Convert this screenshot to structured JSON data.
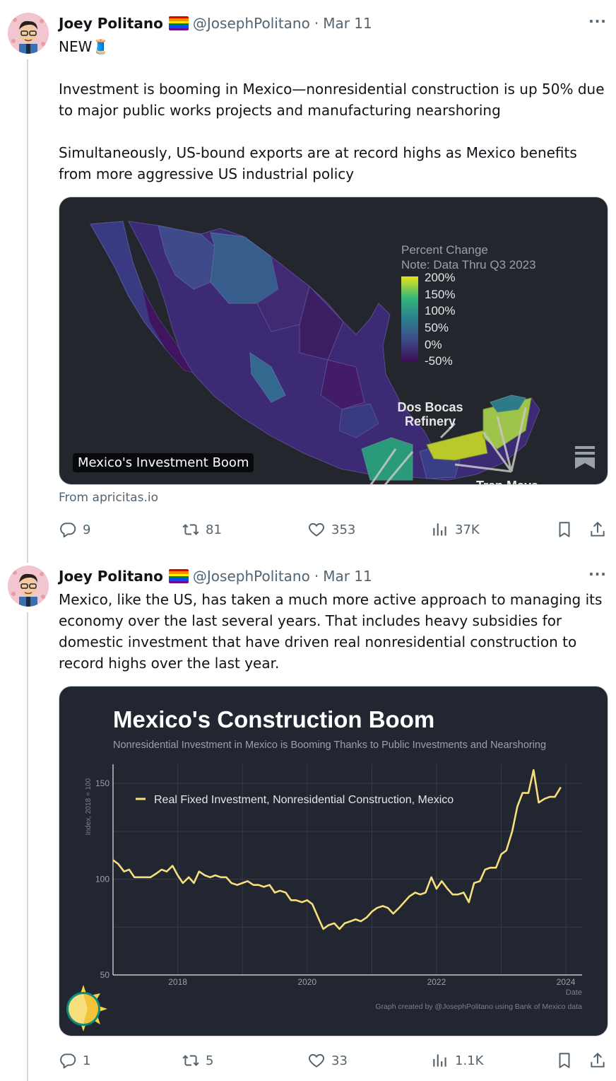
{
  "tweets": [
    {
      "author_name": "Joey Politano",
      "handle": "@JosephPolitano",
      "date": "Mar 11",
      "text": "NEW🧵\n\nInvestment is booming in Mexico—nonresidential construction is up 50% due to major public works projects and manufacturing nearshoring\n\nSimultaneously, US-bound exports are at record highs as Mexico benefits from more aggressive US industrial policy",
      "media": {
        "caption": "Mexico's Investment Boom",
        "legend_title": "Percent Change",
        "legend_note": "Note: Data Thru Q3 2023",
        "legend_ticks": [
          "200%",
          "150%",
          "100%",
          "50%",
          "0%",
          "-50%"
        ],
        "annotation_1": "Dos Bocas",
        "annotation_2": "Refinery",
        "annotation_3": "Tren Maya"
      },
      "source": "From apricitas.io",
      "replies": "9",
      "retweets": "81",
      "likes": "353",
      "views": "37K"
    },
    {
      "author_name": "Joey Politano",
      "handle": "@JosephPolitano",
      "date": "Mar 11",
      "text": "Mexico, like the US, has taken a much more active approach to managing its economy over the last several years. That includes heavy subsidies for domestic investment that have driven real nonresidential construction to record highs over the last year.",
      "replies": "1",
      "retweets": "5",
      "likes": "33",
      "views": "1.1K"
    }
  ],
  "icons": {
    "reply": "reply-icon",
    "retweet": "retweet-icon",
    "like": "heart-icon",
    "views": "views-icon",
    "bookmark": "bookmark-icon",
    "share": "share-icon",
    "more": "more-icon"
  },
  "colors": {
    "accent_line": "#f6df7c",
    "chart_bg": "#222630",
    "map_bg": "#23262c"
  },
  "chart_data": {
    "type": "line",
    "title": "Mexico's Construction Boom",
    "subtitle": "Nonresidential Investment in Mexico is Booming Thanks to Public Investments and Nearshoring",
    "xlabel": "Date",
    "ylabel": "Index, 2018 = 100",
    "credit": "Graph created by @JosephPolitano using Bank of Mexico data",
    "xlim": [
      2017.0,
      2024.25
    ],
    "ylim": [
      50,
      160
    ],
    "x_ticks": [
      2018,
      2020,
      2022,
      2024
    ],
    "y_ticks": [
      50,
      100,
      150
    ],
    "grid": true,
    "legend_position": "top-left",
    "series": [
      {
        "name": "Real Fixed Investment, Nonresidential Construction, Mexico",
        "x": [
          2017.0,
          2017.08,
          2017.17,
          2017.25,
          2017.33,
          2017.42,
          2017.5,
          2017.58,
          2017.67,
          2017.75,
          2017.83,
          2017.92,
          2018.0,
          2018.08,
          2018.17,
          2018.25,
          2018.33,
          2018.42,
          2018.5,
          2018.58,
          2018.67,
          2018.75,
          2018.83,
          2018.92,
          2019.0,
          2019.08,
          2019.17,
          2019.25,
          2019.33,
          2019.42,
          2019.5,
          2019.58,
          2019.67,
          2019.75,
          2019.83,
          2019.92,
          2020.0,
          2020.08,
          2020.17,
          2020.25,
          2020.33,
          2020.42,
          2020.5,
          2020.58,
          2020.67,
          2020.75,
          2020.83,
          2020.92,
          2021.0,
          2021.08,
          2021.17,
          2021.25,
          2021.33,
          2021.42,
          2021.5,
          2021.58,
          2021.67,
          2021.75,
          2021.83,
          2021.92,
          2022.0,
          2022.08,
          2022.17,
          2022.25,
          2022.33,
          2022.42,
          2022.5,
          2022.58,
          2022.67,
          2022.75,
          2022.83,
          2022.92,
          2023.0,
          2023.08,
          2023.17,
          2023.25,
          2023.33,
          2023.42,
          2023.5,
          2023.58,
          2023.67,
          2023.75,
          2023.83,
          2023.92
        ],
        "y": [
          110,
          108,
          104,
          105,
          101,
          101,
          101,
          101,
          103,
          105,
          104,
          107,
          102,
          98,
          101,
          98,
          104,
          102,
          101,
          102,
          101,
          101,
          98,
          97,
          98,
          99,
          97,
          97,
          96,
          97,
          93,
          94,
          93,
          89,
          89,
          88,
          89,
          87,
          80,
          74,
          76,
          77,
          74,
          77,
          78,
          79,
          78,
          80,
          83,
          85,
          86,
          85,
          82,
          85,
          88,
          91,
          93,
          92,
          93,
          101,
          95,
          99,
          95,
          92,
          92,
          93,
          88,
          98,
          99,
          105,
          106,
          106,
          113,
          115,
          125,
          138,
          145,
          145,
          157,
          140,
          142,
          143,
          143,
          148
        ]
      }
    ]
  }
}
